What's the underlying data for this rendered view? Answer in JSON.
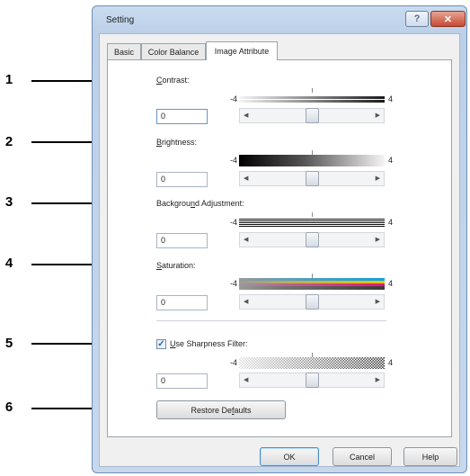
{
  "callouts": [
    "1",
    "2",
    "3",
    "4",
    "5",
    "6"
  ],
  "dialog": {
    "title": "Setting",
    "help_label": "?",
    "close_label": "✕",
    "tabs": [
      "Basic",
      "Color Balance",
      "Image Attribute"
    ],
    "active_tab": "Image Attribute",
    "settings": {
      "contrast": {
        "label_key": "C",
        "label_rest": "ontrast:",
        "value": "0",
        "min": "-4",
        "max": "4",
        "level": 0
      },
      "brightness": {
        "label_key": "B",
        "label_rest": "rightness:",
        "value": "0",
        "min": "-4",
        "max": "4",
        "level": 0
      },
      "background": {
        "label_pre": "Backgrou",
        "label_key": "n",
        "label_rest": "d Adjustment:",
        "value": "0",
        "min": "-4",
        "max": "4",
        "level": 0
      },
      "saturation": {
        "label_key": "S",
        "label_rest": "aturation:",
        "value": "0",
        "min": "-4",
        "max": "4",
        "level": 0
      },
      "sharpness": {
        "label_key": "U",
        "label_rest": "se Sharpness Filter:",
        "checked": true,
        "value": "0",
        "min": "-4",
        "max": "4",
        "level": 0
      }
    },
    "slider_arrows": {
      "left": "◀",
      "right": "▶"
    },
    "restore_pre": "Restore De",
    "restore_key": "f",
    "restore_rest": "aults",
    "buttons": {
      "ok": "OK",
      "cancel": "Cancel",
      "help": "Help"
    }
  },
  "colors": {
    "window_frame": "#bcd0e8",
    "close_button": "#c74a35",
    "focus_border": "#4a8ec9"
  }
}
